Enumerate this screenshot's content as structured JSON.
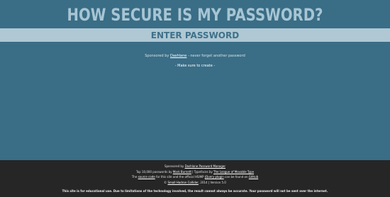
{
  "header": {
    "title": "HOW SECURE IS MY PASSWORD?"
  },
  "password_field": {
    "placeholder": "ENTER PASSWORD",
    "value": ""
  },
  "sponsor": {
    "prefix": "Sponsored by ",
    "link": "Dashlane",
    "suffix": " - never forget another password"
  },
  "create_link": "- Make sure to create -",
  "footer": {
    "line1_prefix": "Sponsored by ",
    "line1_link": "Dashlane Password Manager",
    "line2_prefix": "Top 10,000 passwords by ",
    "line2_link1": "Mark Burnett",
    "line2_mid": " | Typefaces by ",
    "line2_link2": "The League of Movable Type",
    "line3_prefix": "The ",
    "line3_link1": "source code",
    "line3_mid1": " for this site and the official ",
    "line3_mid2": "HSIMP ",
    "line3_link2": "jQuery plugin",
    "line3_mid3": " can be found on ",
    "line3_link3": "Github",
    "line4_prefix": "© ",
    "line4_link": "Small Hadron Collider",
    "line4_suffix": ", 2014 | Version 5.0",
    "disclaimer": "This site is for educational use. Due to limitations of the technology involved, the result cannot always be accurate. Your password will not be sent over the internet."
  }
}
